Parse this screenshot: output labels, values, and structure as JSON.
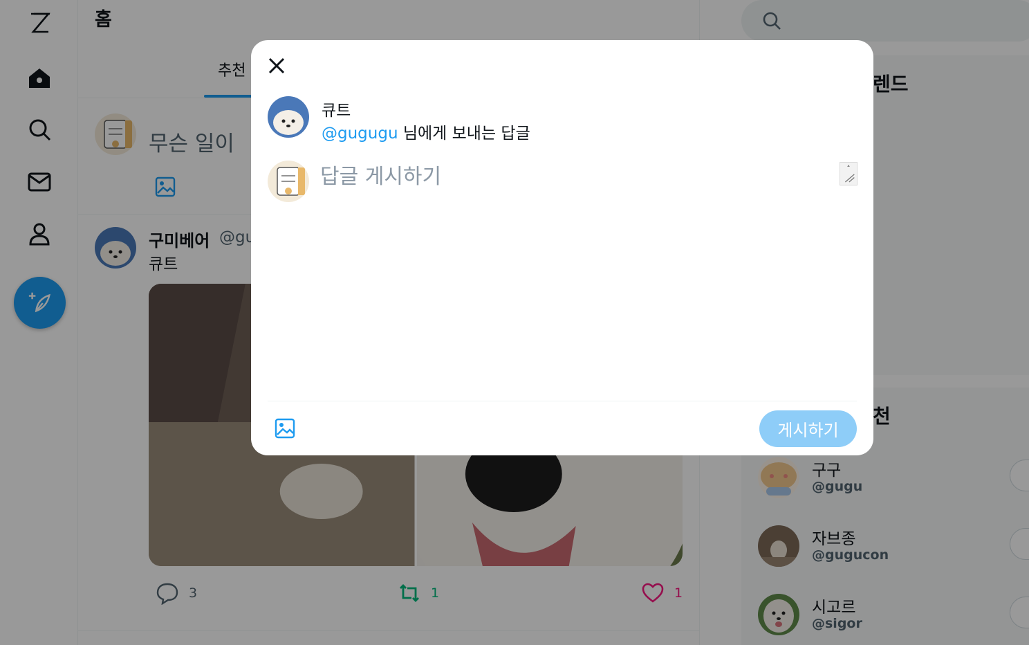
{
  "nav": {
    "icons": [
      "logo-z-icon",
      "home-icon",
      "search-icon",
      "mail-icon",
      "profile-icon",
      "compose-feather-icon"
    ]
  },
  "main": {
    "title": "홈",
    "tabs": [
      {
        "label": "추천",
        "active": true
      }
    ],
    "composer": {
      "placeholder": "무슨 일이 "
    },
    "post": {
      "author": "구미베어",
      "handle": "@gu",
      "text": "큐트",
      "actions": {
        "reply_count": "3",
        "retweet_count": "1",
        "like_count": "1"
      }
    }
  },
  "right": {
    "trend_title": "렌드",
    "follow_title": "천",
    "follow": [
      {
        "name": "구구",
        "handle": "@gugu"
      },
      {
        "name": "자브종",
        "handle": "@gugucon"
      },
      {
        "name": "시고르",
        "handle": "@sigor"
      }
    ]
  },
  "modal": {
    "reply_author_name": "큐트",
    "reply_mention": "@gugugu",
    "reply_to_suffix": " 님에게 보내는 답글",
    "input_placeholder": "답글 게시하기",
    "submit_label": "게시하기"
  },
  "colors": {
    "accent": "#1d9bf0",
    "submit_disabled": "#8ecdf8",
    "retweet": "#00ba7c",
    "like": "#f91880",
    "overlay": "rgba(0,0,0,0.40)"
  }
}
